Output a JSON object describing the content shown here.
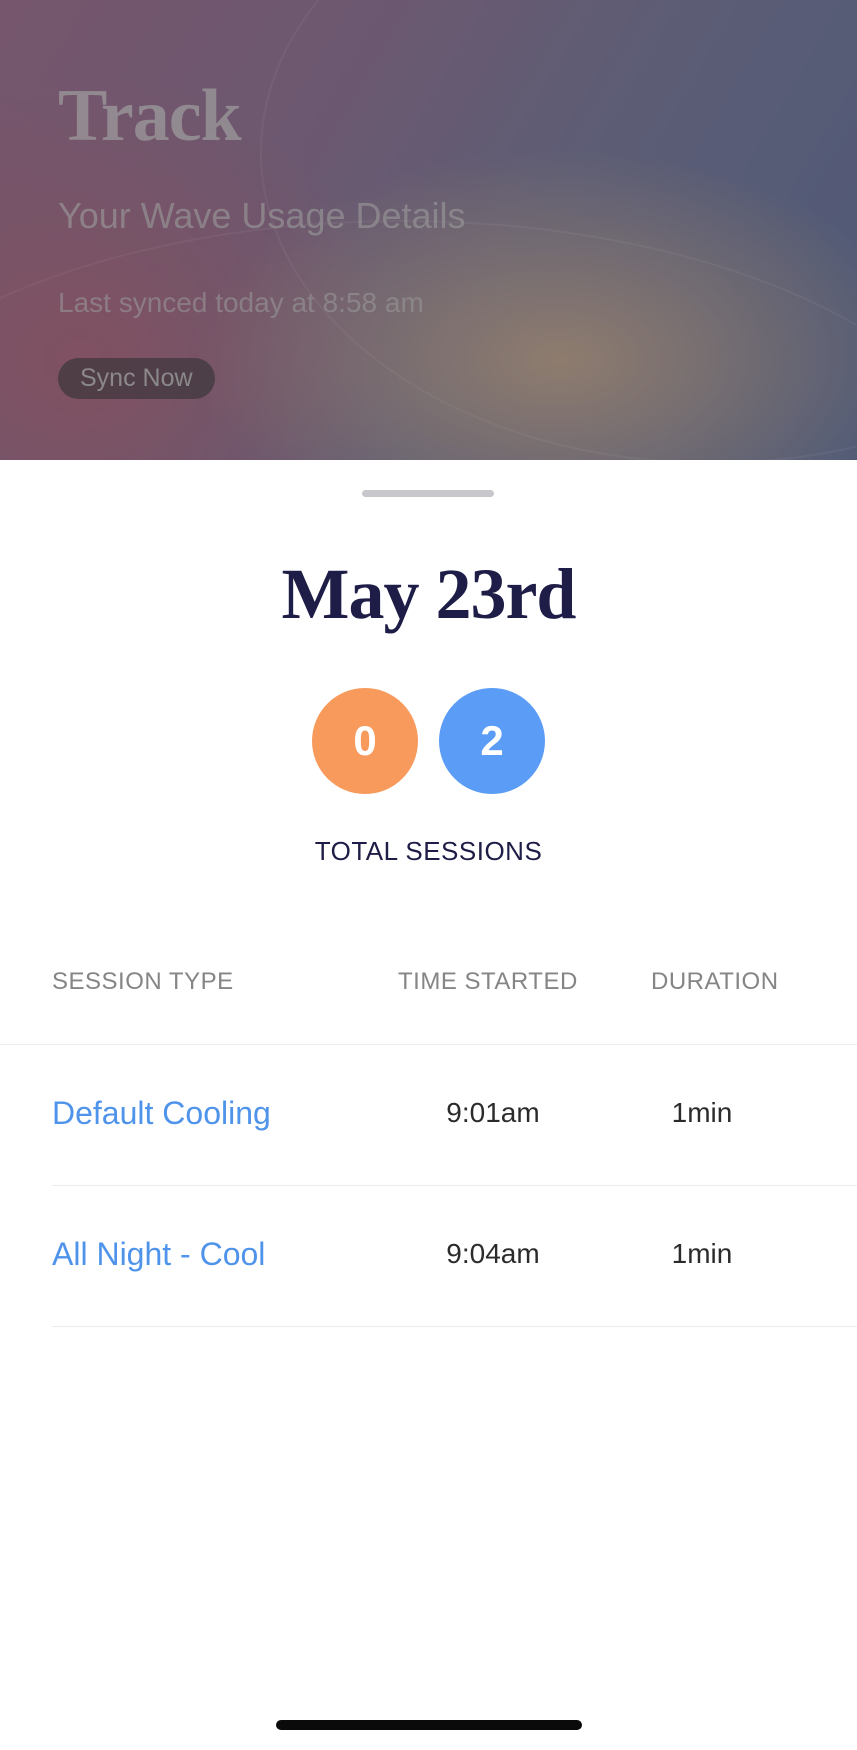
{
  "header": {
    "title": "Track",
    "subtitle": "Your Wave Usage Details",
    "last_synced": "Last synced today at 8:58 am",
    "sync_button": "Sync Now"
  },
  "sheet": {
    "date": "May 23rd",
    "counters": [
      {
        "value": "0",
        "color": "#f79a5c"
      },
      {
        "value": "2",
        "color": "#5b9cf6"
      }
    ],
    "total_label": "TOTAL SESSIONS",
    "table": {
      "columns": [
        "SESSION TYPE",
        "TIME STARTED",
        "DURATION"
      ],
      "rows": [
        {
          "type": "Default Cooling",
          "time": "9:01am",
          "duration": "1min"
        },
        {
          "type": "All Night - Cool",
          "time": "9:04am",
          "duration": "1min"
        }
      ]
    }
  }
}
